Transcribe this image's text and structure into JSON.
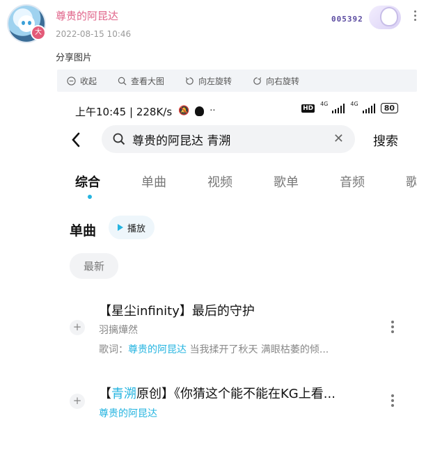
{
  "post": {
    "username": "尊贵的阿昆达",
    "timestamp": "2022-08-15 10:46",
    "fan_id": "005392",
    "avatar_badge": "大",
    "caption": "分享图片"
  },
  "toolbar": {
    "collapse_label": "收起",
    "view_large_label": "查看大图",
    "rotate_left_label": "向左旋转",
    "rotate_right_label": "向右旋转"
  },
  "screenshot": {
    "status_time": "上午10:45 | 228K/s",
    "status_dots": "··",
    "network_badge": "HD",
    "signal_label_1": "4G",
    "signal_label_2": "4G",
    "battery": "80",
    "search_value": "尊贵的阿昆达 青溯",
    "search_button": "搜索",
    "tabs": [
      "综合",
      "单曲",
      "视频",
      "歌单",
      "音频",
      "歌"
    ],
    "active_tab": 0,
    "section_title": "单曲",
    "play_label": "播放",
    "sort_label": "最新",
    "songs": [
      {
        "title": "【星尘infinity】最后的守护",
        "artist": "羽摛燁然",
        "lyric_prefix": "歌词：",
        "lyric_highlight": "尊贵的阿昆达",
        "lyric_rest": " 当我揉开了秋天 满眼枯萎的倾..."
      },
      {
        "title_prefix": "【",
        "title_highlight": "青溯",
        "title_rest": "原创】《你猜这个能不能在KG上看...",
        "artist": "尊贵的阿昆达"
      }
    ]
  },
  "colors": {
    "username": "#e0648a",
    "accent": "#25b4e0",
    "toolbar_bg": "#f2f4f7"
  }
}
